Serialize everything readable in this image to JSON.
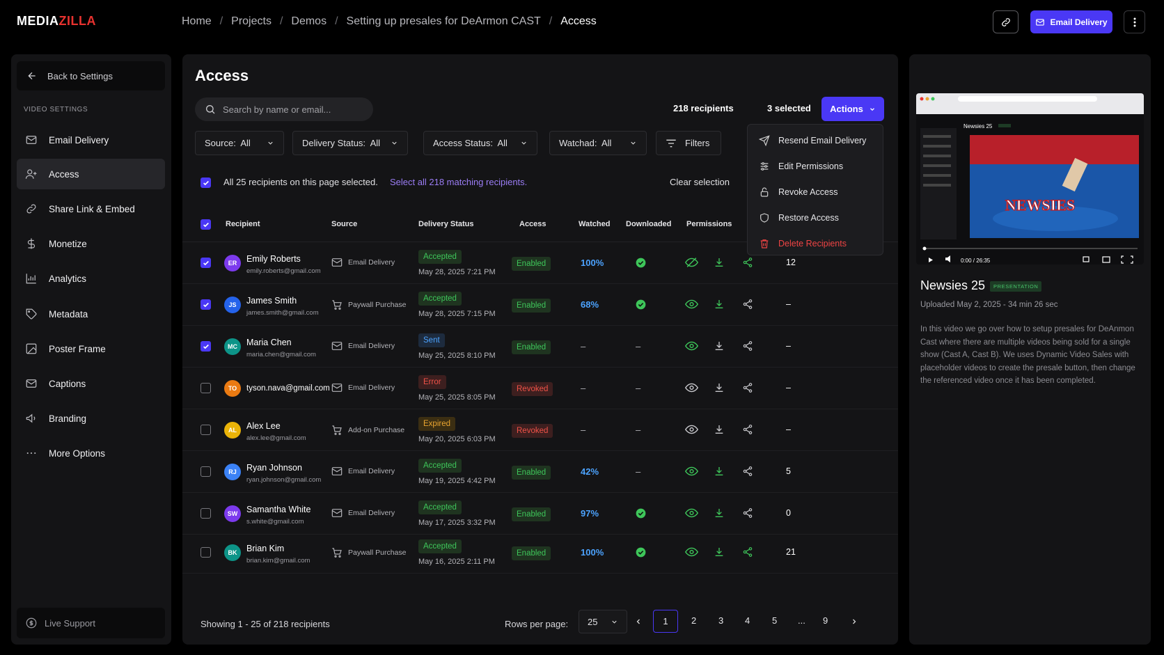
{
  "brand": {
    "prefix": "MEDIA",
    "suffix": "ZILLA"
  },
  "breadcrumbs": [
    "Home",
    "Projects",
    "Demos",
    "Setting up presales for DeArmon CAST",
    "Access"
  ],
  "header": {
    "email_delivery_label": "Email Delivery"
  },
  "sidebar": {
    "back_label": "Back to Settings",
    "section_label": "VIDEO SETTINGS",
    "items": [
      {
        "label": "Email Delivery",
        "icon": "mail-icon"
      },
      {
        "label": "Access",
        "icon": "user-plus-icon"
      },
      {
        "label": "Share Link & Embed",
        "icon": "link-icon"
      },
      {
        "label": "Monetize",
        "icon": "dollar-icon"
      },
      {
        "label": "Analytics",
        "icon": "bar-chart-icon"
      },
      {
        "label": "Metadata",
        "icon": "tag-icon"
      },
      {
        "label": "Poster Frame",
        "icon": "image-icon"
      },
      {
        "label": "Captions",
        "icon": "captions-icon"
      },
      {
        "label": "Branding",
        "icon": "megaphone-icon"
      },
      {
        "label": "More Options",
        "icon": "ellipsis-icon"
      }
    ],
    "live_support": "Live Support"
  },
  "main": {
    "title": "Access",
    "search_placeholder": "Search by name or email...",
    "recipients_count": "218 recipients",
    "selected_count": "3 selected",
    "actions_label": "Actions",
    "filters": [
      {
        "label": "Source:",
        "value": "All"
      },
      {
        "label": "Delivery Status:",
        "value": "All"
      },
      {
        "label": "Access Status:",
        "value": "All"
      },
      {
        "label": "Watchad:",
        "value": "All"
      }
    ],
    "filters_button": "Filters",
    "selection_text": "All 25 recipients on this page selected.",
    "select_all_link": "Select all 218 matching recipients.",
    "clear_selection": "Clear selection",
    "columns": [
      "Recipient",
      "Source",
      "Delivery Status",
      "Access",
      "Watched",
      "Downloaded",
      "Permissions"
    ],
    "rows": [
      {
        "checked": true,
        "initials": "ER",
        "color": "#7c3aed",
        "name": "Emily Roberts",
        "email": "emily.roberts@gmail.com",
        "source": "Email Delivery",
        "src_icon": "mail",
        "status": "Accepted",
        "status_kind": "acc",
        "date": "May 28, 2025 7:21 PM",
        "access": "Enabled",
        "watched": "100%",
        "downloaded": true,
        "total": "12",
        "perm_first": "blocked"
      },
      {
        "checked": true,
        "initials": "JS",
        "color": "#2563eb",
        "name": "James Smith",
        "email": "james.smith@gmail.com",
        "source": "Paywall Purchase",
        "src_icon": "cart",
        "status": "Accepted",
        "status_kind": "acc",
        "date": "May 28, 2025 7:15 PM",
        "access": "Enabled",
        "watched": "68%",
        "downloaded": true,
        "total": "–",
        "perm_first": "eye"
      },
      {
        "checked": true,
        "initials": "MC",
        "color": "#0d9488",
        "name": "Maria Chen",
        "email": "maria.chen@gmail.com",
        "source": "Email Delivery",
        "src_icon": "mail",
        "status": "Sent",
        "status_kind": "sent",
        "date": "May 25, 2025 8:10 PM",
        "access": "Enabled",
        "watched": "–",
        "downloaded": false,
        "total": "–",
        "perm_first": "eye"
      },
      {
        "checked": false,
        "initials": "TO",
        "color": "#ea7a12",
        "name": "",
        "email": "tyson.nava@gmail.com",
        "source": "Email Delivery",
        "src_icon": "mail",
        "status": "Error",
        "status_kind": "err",
        "date": "May 25, 2025 8:05 PM",
        "access": "Revoked",
        "watched": "–",
        "downloaded": false,
        "total": "–",
        "perm_first": "eye"
      },
      {
        "checked": false,
        "initials": "AL",
        "color": "#eab308",
        "name": "Alex Lee",
        "email": "alex.lee@gmail.com",
        "source": "Add-on Purchase",
        "src_icon": "cart",
        "status": "Expired",
        "status_kind": "exp",
        "date": "May 20, 2025 6:03 PM",
        "access": "Revoked",
        "watched": "–",
        "downloaded": false,
        "total": "–",
        "perm_first": "eye"
      },
      {
        "checked": false,
        "initials": "RJ",
        "color": "#3b82f6",
        "name": "Ryan Johnson",
        "email": "ryan.johnson@gmail.com",
        "source": "Email Delivery",
        "src_icon": "mail",
        "status": "Accepted",
        "status_kind": "acc",
        "date": "May 19, 2025 4:42 PM",
        "access": "Enabled",
        "watched": "42%",
        "downloaded": false,
        "total": "5",
        "perm_first": "eye"
      },
      {
        "checked": false,
        "initials": "SW",
        "color": "#7c3aed",
        "name": "Samantha White",
        "email": "s.white@gmail.com",
        "source": "Email Delivery",
        "src_icon": "mail",
        "status": "Accepted",
        "status_kind": "acc",
        "date": "May 17, 2025 3:32 PM",
        "access": "Enabled",
        "watched": "97%",
        "downloaded": true,
        "total": "0",
        "perm_first": "eye"
      },
      {
        "checked": false,
        "initials": "BK",
        "color": "#0d9488",
        "name": "Brian Kim",
        "email": "brian.kim@gmail.com",
        "source": "Paywall Purchase",
        "src_icon": "cart",
        "status": "Accepted",
        "status_kind": "acc",
        "date": "May 16, 2025 2:11 PM",
        "access": "Enabled",
        "watched": "100%",
        "downloaded": true,
        "total": "21",
        "perm_first": "eye"
      }
    ],
    "footer": {
      "showing": "Showing 1 - 25 of 218 recipients",
      "rows_per_page_label": "Rows per page:",
      "rows_per_page": "25",
      "pages": [
        "1",
        "2",
        "3",
        "4",
        "5",
        "...",
        "9"
      ],
      "current_page": "1"
    },
    "dropdown": [
      "Resend Email Delivery",
      "Edit Permissions",
      "Revoke Access",
      "Restore Access",
      "Delete Recipients"
    ]
  },
  "video": {
    "title": "Newsies 25",
    "tag": "PRESENTATION",
    "uploaded": "Uploaded May 2, 2025  -  34 min 26 sec",
    "description": "In this video we go over how to setup presales for DeAnmon Cast where there are multiple videos being sold for a single show (Cast A, Cast B). We uses Dynamic Video Sales with placeholder videos to create the presale button, then change the referenced video once it has been completed.",
    "time": "0:00 / 26:35",
    "inner_title": "Newsies 25",
    "poster_text": "NEWSIES"
  },
  "colors": {
    "accent": "#4a38f5",
    "success": "#3ec65a",
    "info": "#4ca3ff",
    "danger": "#f05248",
    "warning": "#e9a530"
  }
}
